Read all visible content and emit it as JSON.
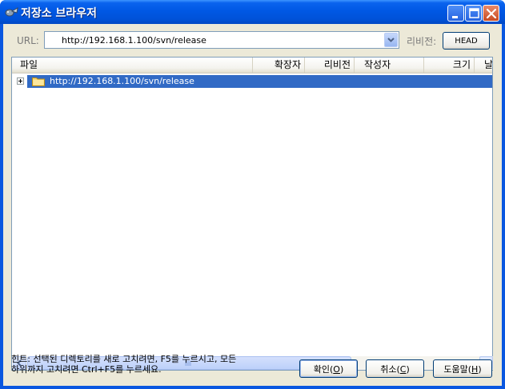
{
  "window": {
    "title": "저장소 브라우저",
    "icon": "repo-browser-icon"
  },
  "titlebar_buttons": {
    "minimize_icon": "minimize-icon",
    "maximize_icon": "maximize-icon",
    "close_icon": "close-icon"
  },
  "toolbar": {
    "url_label": "URL:",
    "url_value": "http://192.168.1.100/svn/release",
    "revision_label": "리비전:",
    "revision_button": "HEAD"
  },
  "list": {
    "columns": [
      "파일",
      "확장자",
      "리비전",
      "작성자",
      "크기",
      "날"
    ],
    "rows": [
      {
        "name": "http://192.168.1.100/svn/release",
        "icon": "folder-icon",
        "selected": true,
        "expandable": true
      }
    ]
  },
  "footer": {
    "hint_line1": "힌트: 선택된 디렉토리를 새로 고치려면, F5를 누르시고, 모든",
    "hint_line2": "하위까지 고치려면 Ctrl+F5를 누르세요.",
    "ok_button": "확인(O)",
    "ok_text": "확인(",
    "ok_key": "O",
    "cancel_text": "취소(",
    "cancel_key": "C",
    "help_text": "도움말(",
    "help_key": "H",
    "close_paren": ")"
  },
  "colors": {
    "titlebar": "#0058e4",
    "selection": "#316ac5",
    "dialog_bg": "#ece9d8"
  }
}
